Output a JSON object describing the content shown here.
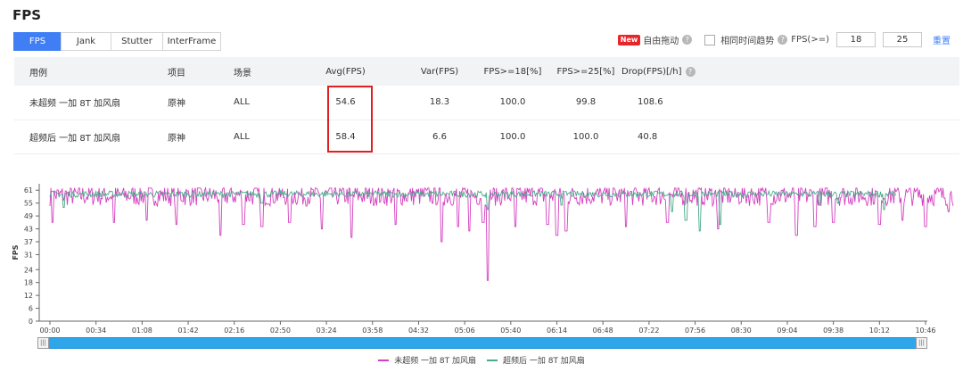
{
  "title": "FPS",
  "tabs": [
    "FPS",
    "Jank",
    "Stutter",
    "InterFrame"
  ],
  "controls": {
    "new_badge": "New",
    "free_drag": "自由拖动",
    "same_time_trend": "相同时间趋势",
    "fps_ge_label": "FPS(>=)",
    "fps_ge_value1": "18",
    "fps_ge_value2": "25",
    "reset": "重置"
  },
  "table": {
    "headers": [
      "用例",
      "项目",
      "场景",
      "Avg(FPS)",
      "Var(FPS)",
      "FPS>=18[%]",
      "FPS>=25[%]",
      "Drop(FPS)[/h]"
    ],
    "rows": [
      [
        "未超频 一加 8T 加风扇",
        "原神",
        "ALL",
        "54.6",
        "18.3",
        "100.0",
        "99.8",
        "108.6"
      ],
      [
        "超频后 一加 8T 加风扇",
        "原神",
        "ALL",
        "58.4",
        "6.6",
        "100.0",
        "100.0",
        "40.8"
      ]
    ]
  },
  "chart_data": {
    "type": "line",
    "ylabel": "FPS",
    "yticks": [
      0,
      6,
      12,
      18,
      24,
      31,
      37,
      43,
      49,
      55,
      61
    ],
    "ylim": [
      0,
      64
    ],
    "x_ticks": [
      "00:00",
      "00:34",
      "01:08",
      "01:42",
      "02:16",
      "02:50",
      "03:24",
      "03:58",
      "04:32",
      "05:06",
      "05:40",
      "06:14",
      "06:48",
      "07:22",
      "07:56",
      "08:30",
      "09:04",
      "09:38",
      "10:12",
      "10:46"
    ],
    "series": [
      {
        "name": "未超频 一加 8T 加风扇",
        "color": "#d43fbf",
        "end_tick_fraction": 19.6,
        "base": 54.6,
        "dips": [
          [
            0.05,
            46
          ],
          [
            1.4,
            46
          ],
          [
            2.1,
            47
          ],
          [
            2.75,
            45
          ],
          [
            3.7,
            40
          ],
          [
            4.2,
            45
          ],
          [
            4.6,
            44
          ],
          [
            5.2,
            46
          ],
          [
            5.9,
            43
          ],
          [
            6.55,
            39
          ],
          [
            7.5,
            45
          ],
          [
            8.5,
            37
          ],
          [
            8.85,
            44
          ],
          [
            9.1,
            42
          ],
          [
            9.4,
            46
          ],
          [
            9.5,
            19
          ],
          [
            10.1,
            44
          ],
          [
            10.8,
            45
          ],
          [
            11.0,
            40
          ],
          [
            11.2,
            42
          ],
          [
            12.5,
            44
          ],
          [
            13.4,
            46
          ],
          [
            14.5,
            43
          ],
          [
            15.6,
            46
          ],
          [
            16.2,
            40
          ],
          [
            16.6,
            44
          ],
          [
            17.0,
            46
          ],
          [
            18.0,
            45
          ],
          [
            18.5,
            47
          ],
          [
            19.0,
            44
          ],
          [
            19.5,
            51
          ]
        ]
      },
      {
        "name": "超频后 一加 8T 加风扇",
        "color": "#4aa88c",
        "end_tick_fraction": 18.35,
        "base": 58.4,
        "dips": [
          [
            0.3,
            53
          ],
          [
            4.6,
            55
          ],
          [
            9.5,
            52
          ],
          [
            11.1,
            54
          ],
          [
            13.5,
            51
          ],
          [
            13.8,
            47
          ],
          [
            14.1,
            42
          ],
          [
            14.55,
            45
          ],
          [
            16.7,
            54
          ],
          [
            17.1,
            55
          ],
          [
            18.1,
            52
          ]
        ]
      }
    ],
    "grid": false,
    "legend": "bottom-center"
  },
  "slider": {
    "left_handle": "|||",
    "right_handle": "|||"
  }
}
